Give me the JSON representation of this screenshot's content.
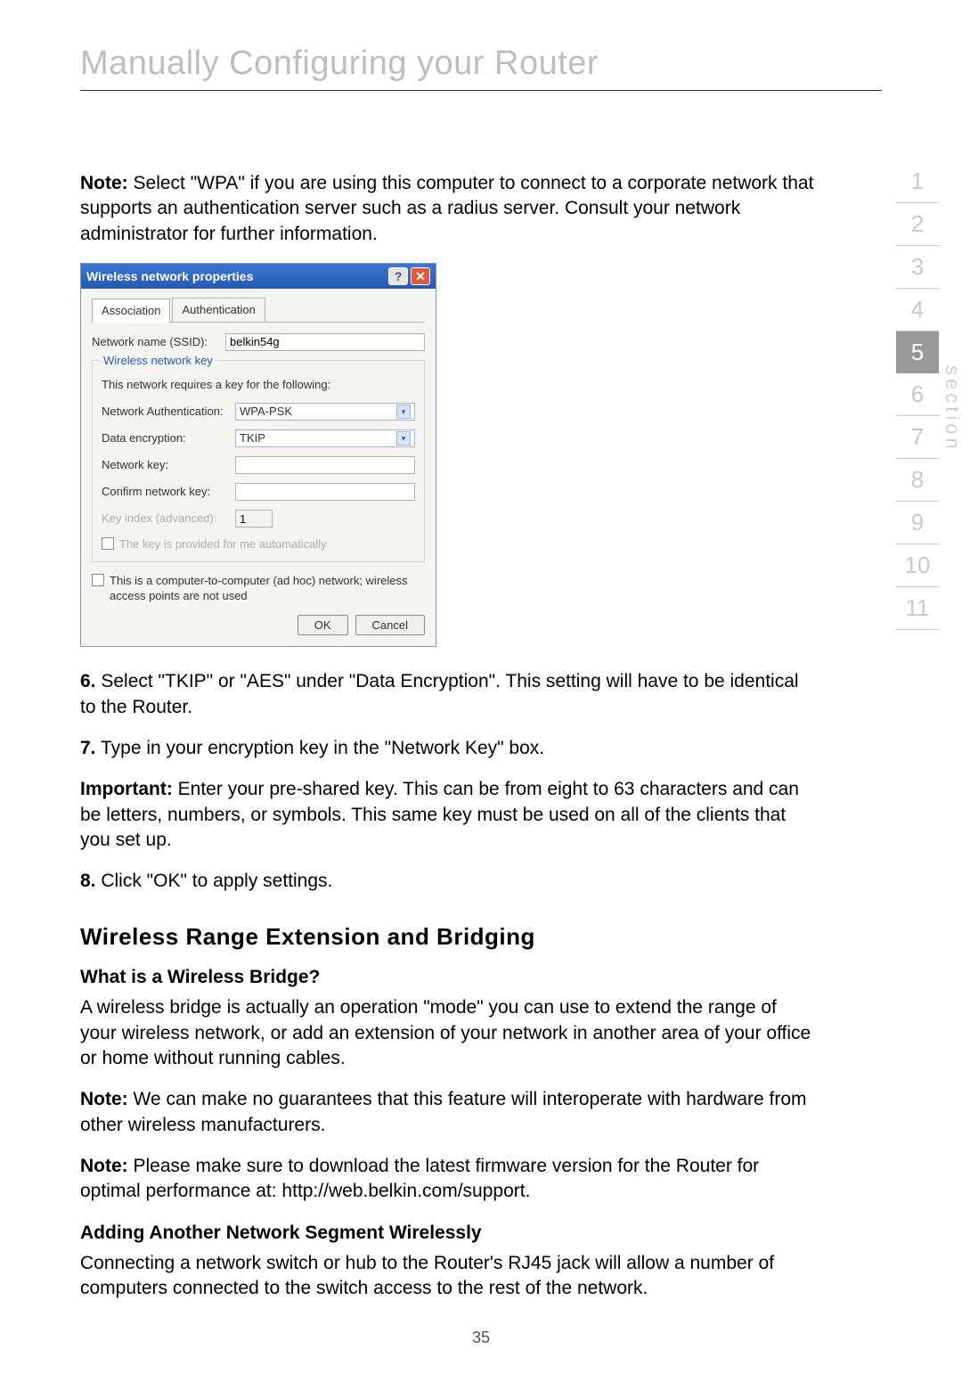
{
  "page_title": "Manually Configuring your Router",
  "note1_label": "Note:",
  "note1_text": " Select \"WPA\" if you are using this computer to connect to a corporate network that supports an authentication server such as a radius server. Consult your network administrator for further information.",
  "dialog": {
    "title": "Wireless network properties",
    "tabs": {
      "assoc": "Association",
      "auth": "Authentication"
    },
    "ssid_label": "Network name (SSID):",
    "ssid_value": "belkin54g",
    "fieldset_legend": "Wireless network key",
    "fieldset_info": "This network requires a key for the following:",
    "netauth_label": "Network Authentication:",
    "netauth_value": "WPA-PSK",
    "dataenc_label": "Data encryption:",
    "dataenc_value": "TKIP",
    "netkey_label": "Network key:",
    "confkey_label": "Confirm network key:",
    "keyindex_label": "Key index (advanced):",
    "keyindex_value": "1",
    "autokey_label": "The key is provided for me automatically",
    "adhoc_label": "This is a computer-to-computer (ad hoc) network; wireless access points are not used",
    "ok": "OK",
    "cancel": "Cancel"
  },
  "step6_num": "6.",
  "step6_text": " Select \"TKIP\" or \"AES\" under \"Data Encryption\". This setting will have to be identical to the Router.",
  "step7_num": "7.",
  "step7_text": " Type in your encryption key in the \"Network Key\" box.",
  "important_label": "Important:",
  "important_text": " Enter your pre-shared key. This can be from eight to 63 characters and can be letters, numbers, or symbols. This same key must be used on all of the clients that you set up.",
  "step8_num": "8.",
  "step8_text": " Click \"OK\" to apply settings.",
  "h2": "Wireless Range Extension and Bridging",
  "sub1": "What is a Wireless Bridge?",
  "sub1_text": "A wireless bridge is actually an operation \"mode\" you can use to extend the range of your wireless network, or add an extension of your network in another area of your office or home without running cables.",
  "note2_label": "Note:",
  "note2_text": " We can make no guarantees that this feature will interoperate with hardware from other wireless manufacturers.",
  "note3_label": "Note:",
  "note3_text": " Please make sure to download the latest firmware version for the Router for optimal performance at: http://web.belkin.com/support.",
  "sub2": "Adding Another Network Segment Wirelessly",
  "sub2_text": "Connecting a network switch or hub to the Router's RJ45 jack will allow a number of computers connected to the switch access to the rest of the network.",
  "page_number": "35",
  "section_label": "section",
  "nav": [
    "1",
    "2",
    "3",
    "4",
    "5",
    "6",
    "7",
    "8",
    "9",
    "10",
    "11"
  ],
  "nav_active": "5"
}
